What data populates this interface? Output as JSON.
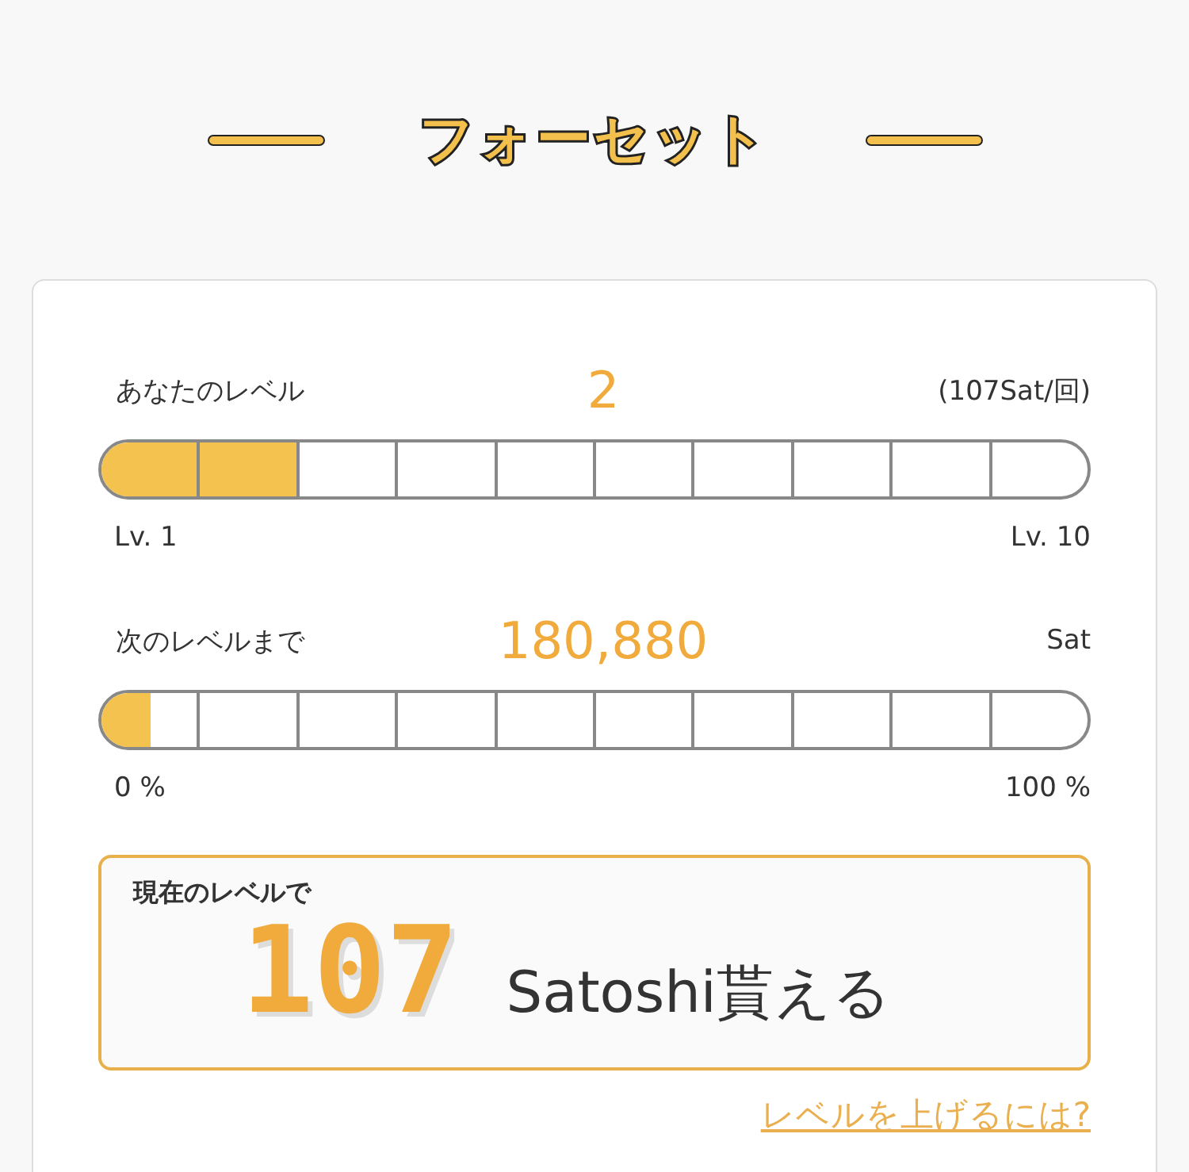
{
  "title": "フォーセット",
  "meters": [
    {
      "label": "あなたのレベル",
      "value": "2",
      "note": "(107Sat/回)",
      "level": 0.2,
      "min_label": "Lv. 1",
      "max_label": "Lv. 10"
    },
    {
      "label": "次のレベルまで",
      "value": "180,880",
      "note": "Sat",
      "level": 0.05,
      "min_label": "0 %",
      "max_label": "100 %"
    }
  ],
  "reward": {
    "caption": "現在のレベルで",
    "amount": "107",
    "suffix": "Satoshi貰える"
  },
  "link": "レベルを上げるには?"
}
